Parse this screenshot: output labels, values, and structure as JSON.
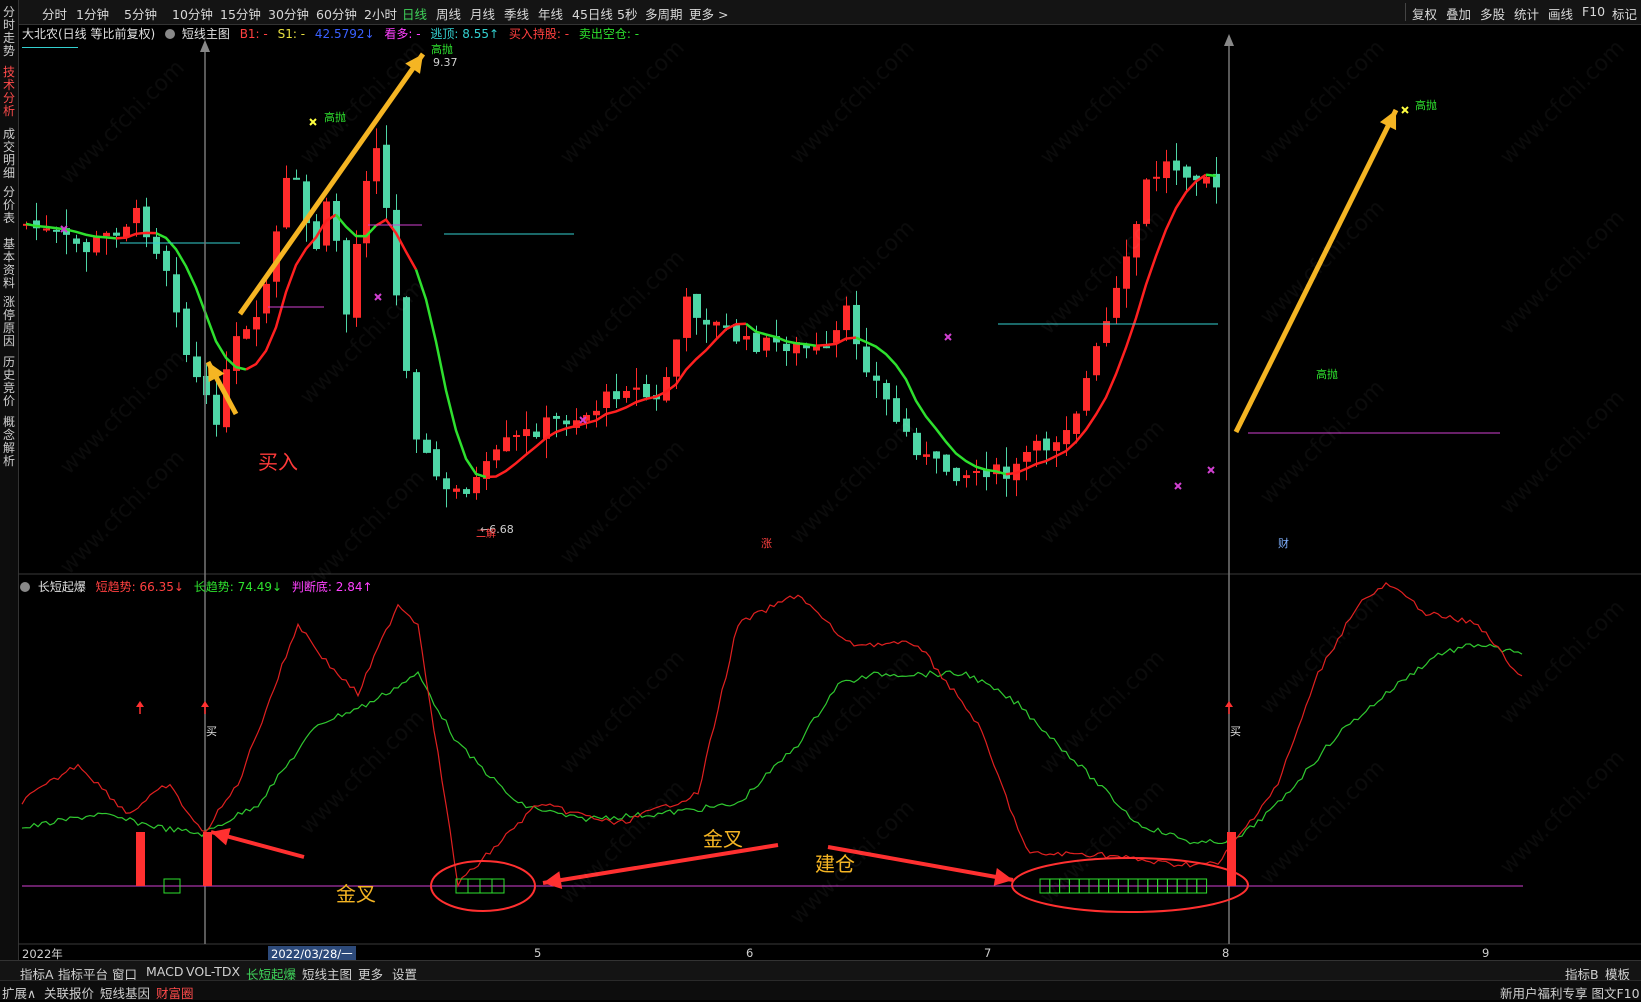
{
  "toolbar": {
    "periods": [
      "分时",
      "1分钟",
      "5分钟",
      "10分钟",
      "15分钟",
      "30分钟",
      "60分钟",
      "2小时",
      "日线",
      "周线",
      "月线",
      "季线",
      "年线",
      "45日线",
      "5秒",
      "多周期",
      "更多 >"
    ],
    "active_period": "日线",
    "right_tools": [
      "复权",
      "叠加",
      "多股",
      "统计",
      "画线",
      "F10",
      "标记"
    ]
  },
  "side_tabs": [
    {
      "label": "分时走势",
      "active": false
    },
    {
      "label": "技术分析",
      "active": true
    },
    {
      "label": "成交明细",
      "active": false
    },
    {
      "label": "分价表",
      "active": false
    },
    {
      "label": "基本资料",
      "active": false
    },
    {
      "label": "涨停原因",
      "active": false
    },
    {
      "label": "历史竞价",
      "active": false
    },
    {
      "label": "概念解析",
      "active": false
    }
  ],
  "main_info": {
    "stock": "大北农(日线 等比前复权)",
    "indicator": "短线主图",
    "b1": "B1: -",
    "s1": "S1: -",
    "extra": "42.5792↓",
    "kanduo": "看多: -",
    "xuanding": "逃顶: 8.55↑",
    "buy_hold": "买入持股: -",
    "sell_empty": "卖出空仓: -"
  },
  "sub_info": {
    "name": "长短起爆",
    "short_trend": "短趋势: 66.35↓",
    "long_trend": "长趋势: 74.49↓",
    "bottom": "判断底: 2.84↑"
  },
  "price_labels": {
    "high1": "9.37",
    "low1": "6.68",
    "low1_text": "二解",
    "gaopao": "高抛",
    "zhang": "涨",
    "cai": "财",
    "mai": "买"
  },
  "annotations": {
    "buy": "买入",
    "golden_cross": "金叉",
    "golden_cross2": "金叉",
    "build_position": "建仓"
  },
  "x_axis": {
    "start": "2022年",
    "cursor_date": "2022/03/28/一",
    "months": [
      "5",
      "6",
      "7",
      "8",
      "9"
    ]
  },
  "bottom_tabs": [
    "指标A",
    "指标平台",
    "窗口",
    "MACD",
    "VOL-TDX",
    "长短起爆",
    "短线主图",
    "更多",
    "设置"
  ],
  "active_bottom_tab": "长短起爆",
  "bottom_right": [
    "指标B",
    "模板"
  ],
  "status_bar": {
    "left": [
      "扩展∧",
      "关联报价",
      "短线基因",
      "财富圈"
    ],
    "right": "新用户福利专享 图文F10"
  },
  "watermark": "www.cfchi.com",
  "colors": {
    "up": "#ff2a2a",
    "down": "#4ed6a6",
    "green_line": "#2ee02e",
    "red_line": "#ff2020",
    "cyan": "#33d0d0",
    "magenta": "#d040d0",
    "arrow": "#f5b523",
    "annotation_red": "#ff3030"
  },
  "chart_data": {
    "type": "candlestick",
    "main_series_note_values": {
      "high_label": 9.37,
      "low_label": 6.68,
      "escape_top": 8.55
    },
    "oscillator": {
      "short_trend_last": 66.35,
      "long_trend_last": 74.49,
      "bottom_last": 2.84
    }
  }
}
